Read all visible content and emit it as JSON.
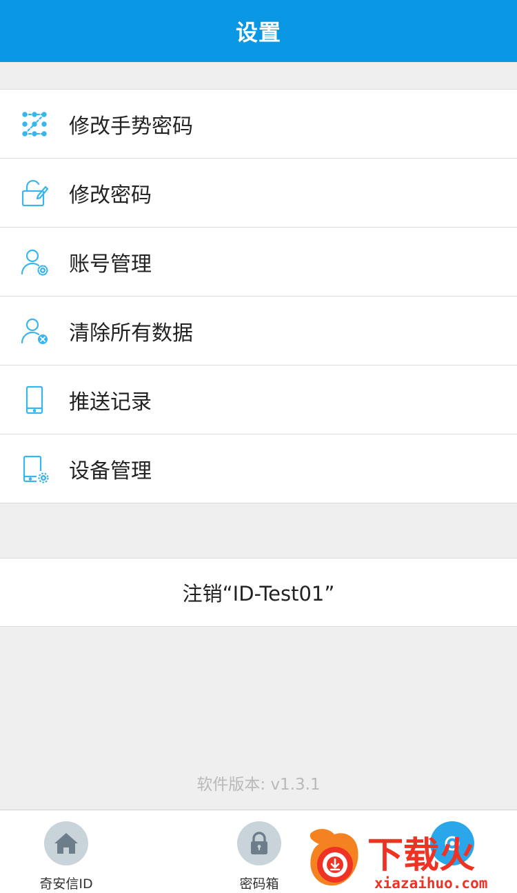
{
  "navbar": {
    "title": "设置"
  },
  "menu": {
    "items": [
      {
        "label": "修改手势密码",
        "icon": "gesture-pattern-icon"
      },
      {
        "label": "修改密码",
        "icon": "lock-edit-icon"
      },
      {
        "label": "账号管理",
        "icon": "user-gear-icon"
      },
      {
        "label": "清除所有数据",
        "icon": "user-remove-icon"
      },
      {
        "label": "推送记录",
        "icon": "phone-icon"
      },
      {
        "label": "设备管理",
        "icon": "device-gear-icon"
      }
    ]
  },
  "logout": {
    "label": "注销“ID-Test01”"
  },
  "footer": {
    "version": "软件版本: v1.3.1"
  },
  "tabbar": {
    "tabs": [
      {
        "label": "奇安信ID",
        "icon": "home-icon"
      },
      {
        "label": "密码箱",
        "icon": "lock-icon"
      },
      {
        "label": "",
        "icon": "settings-tab-icon"
      }
    ]
  },
  "watermark": {
    "brand": "下载火",
    "url": "xiazaihuo.com"
  },
  "colors": {
    "primary": "#0a97e4",
    "icon": "#37b5ee",
    "background": "#efefef",
    "tab_icon_bg": "#c9d3da",
    "watermark_red": "#ee3324",
    "watermark_orange": "#f58220"
  }
}
